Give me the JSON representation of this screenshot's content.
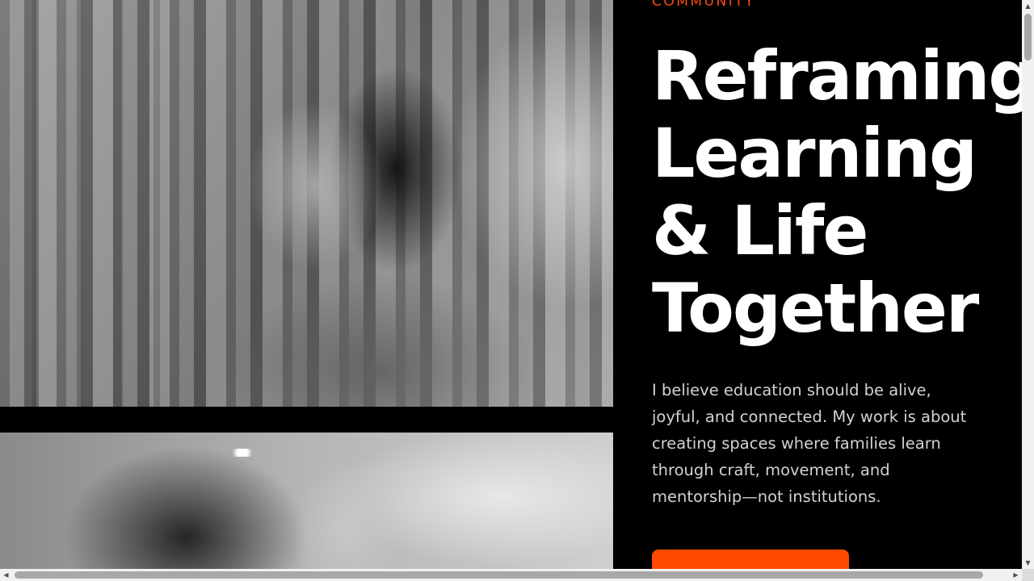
{
  "hero": {
    "eyebrow": "COMMUNITY",
    "headline_lines": [
      "Reframing",
      "Learning",
      "& Life",
      "Together"
    ],
    "body": "I believe education should be alive, joyful, and connected. My work is about creating spaces where families learn through craft, movement, and mentorship—not institutions.",
    "accent_color": "#ff4a12"
  },
  "images": {
    "top": "double-exposure-portrait-woman",
    "bottom": "smiling-woman-portrait"
  },
  "scrollbars": {
    "up_arrow": "▲",
    "down_arrow": "▼",
    "left_arrow": "◀",
    "right_arrow": "▶"
  }
}
